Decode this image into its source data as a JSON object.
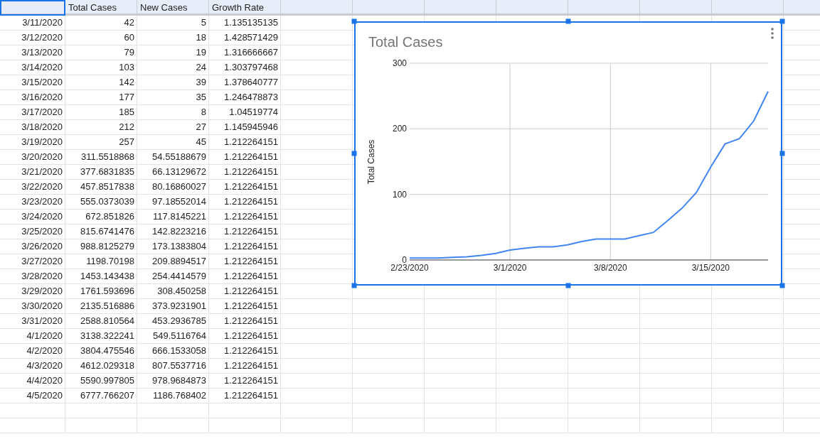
{
  "header": {
    "first_cell_selected": true,
    "labels": [
      "Total Cases",
      "New Cases",
      "Growth Rate"
    ]
  },
  "rows": [
    [
      "3/11/2020",
      "42",
      "5",
      "1.135135135"
    ],
    [
      "3/12/2020",
      "60",
      "18",
      "1.428571429"
    ],
    [
      "3/13/2020",
      "79",
      "19",
      "1.316666667"
    ],
    [
      "3/14/2020",
      "103",
      "24",
      "1.303797468"
    ],
    [
      "3/15/2020",
      "142",
      "39",
      "1.378640777"
    ],
    [
      "3/16/2020",
      "177",
      "35",
      "1.246478873"
    ],
    [
      "3/17/2020",
      "185",
      "8",
      "1.04519774"
    ],
    [
      "3/18/2020",
      "212",
      "27",
      "1.145945946"
    ],
    [
      "3/19/2020",
      "257",
      "45",
      "1.212264151"
    ],
    [
      "3/20/2020",
      "311.5518868",
      "54.55188679",
      "1.212264151"
    ],
    [
      "3/21/2020",
      "377.6831835",
      "66.13129672",
      "1.212264151"
    ],
    [
      "3/22/2020",
      "457.8517838",
      "80.16860027",
      "1.212264151"
    ],
    [
      "3/23/2020",
      "555.0373039",
      "97.18552014",
      "1.212264151"
    ],
    [
      "3/24/2020",
      "672.851826",
      "117.8145221",
      "1.212264151"
    ],
    [
      "3/25/2020",
      "815.6741476",
      "142.8223216",
      "1.212264151"
    ],
    [
      "3/26/2020",
      "988.8125279",
      "173.1383804",
      "1.212264151"
    ],
    [
      "3/27/2020",
      "1198.70198",
      "209.8894517",
      "1.212264151"
    ],
    [
      "3/28/2020",
      "1453.143438",
      "254.4414579",
      "1.212264151"
    ],
    [
      "3/29/2020",
      "1761.593696",
      "308.450258",
      "1.212264151"
    ],
    [
      "3/30/2020",
      "2135.516886",
      "373.9231901",
      "1.212264151"
    ],
    [
      "3/31/2020",
      "2588.810564",
      "453.2936785",
      "1.212264151"
    ],
    [
      "4/1/2020",
      "3138.322241",
      "549.5116764",
      "1.212264151"
    ],
    [
      "4/2/2020",
      "3804.475546",
      "666.1533058",
      "1.212264151"
    ],
    [
      "4/3/2020",
      "4612.029318",
      "807.5537716",
      "1.212264151"
    ],
    [
      "4/4/2020",
      "5590.997805",
      "978.9684873",
      "1.212264151"
    ],
    [
      "4/5/2020",
      "6777.766207",
      "1186.768402",
      "1.212264151"
    ]
  ],
  "chart": {
    "selected": true,
    "chart_data": {
      "type": "line",
      "title": "Total Cases",
      "ylabel": "Total Cases",
      "categories": [
        "2/23/2020",
        null,
        null,
        null,
        null,
        null,
        null,
        "3/1/2020",
        null,
        null,
        null,
        null,
        null,
        null,
        "3/8/2020",
        null,
        null,
        null,
        null,
        null,
        null,
        "3/15/2020",
        null,
        null,
        null,
        null
      ],
      "series": [
        {
          "color": "#4285f4",
          "values": [
            3,
            3,
            3,
            4,
            5,
            7,
            10,
            15,
            18,
            20,
            20,
            23,
            28,
            32,
            32,
            32,
            37,
            42,
            60,
            79,
            103,
            142,
            177,
            185,
            212,
            257
          ]
        }
      ],
      "ylim": [
        0,
        300
      ],
      "grid": true,
      "yticks": [
        0,
        100,
        200,
        300
      ]
    }
  }
}
